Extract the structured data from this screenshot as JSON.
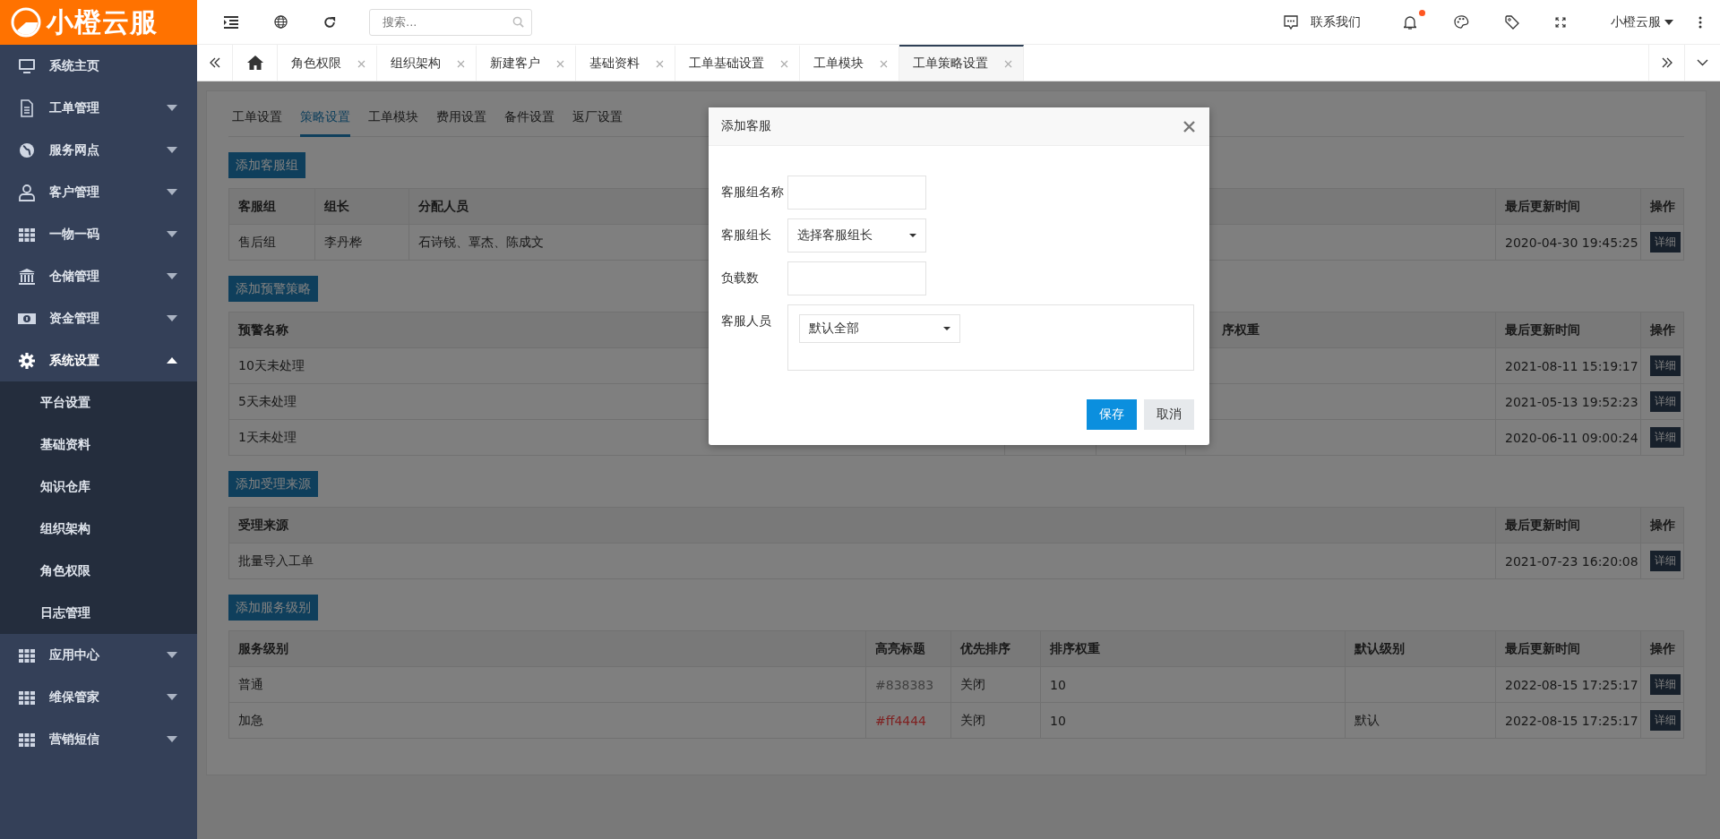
{
  "logo": {
    "text": "小橙云服"
  },
  "sidebar": {
    "items": [
      {
        "label": "系统主页",
        "kind": "link"
      },
      {
        "label": "工单管理",
        "kind": "menu",
        "expanded": false
      },
      {
        "label": "服务网点",
        "kind": "menu",
        "expanded": false
      },
      {
        "label": "客户管理",
        "kind": "menu",
        "expanded": false
      },
      {
        "label": "一物一码",
        "kind": "menu",
        "expanded": false
      },
      {
        "label": "仓储管理",
        "kind": "menu",
        "expanded": false
      },
      {
        "label": "资金管理",
        "kind": "menu",
        "expanded": false
      },
      {
        "label": "系统设置",
        "kind": "menu",
        "expanded": true,
        "children": [
          {
            "label": "平台设置"
          },
          {
            "label": "基础资料"
          },
          {
            "label": "知识仓库"
          },
          {
            "label": "组织架构"
          },
          {
            "label": "角色权限"
          },
          {
            "label": "日志管理"
          }
        ]
      },
      {
        "label": "应用中心",
        "kind": "menu",
        "expanded": false
      },
      {
        "label": "维保管家",
        "kind": "menu",
        "expanded": false
      },
      {
        "label": "营销短信",
        "kind": "menu",
        "expanded": false
      }
    ]
  },
  "toolbar": {
    "search": {
      "placeholder": "搜索..."
    },
    "contact": "联系我们",
    "notifications": {
      "unread": true
    },
    "user": "小橙云服"
  },
  "tabs": [
    {
      "label": "角色权限",
      "selected": false
    },
    {
      "label": "组织架构",
      "selected": false
    },
    {
      "label": "新建客户",
      "selected": false
    },
    {
      "label": "基础资料",
      "selected": false
    },
    {
      "label": "工单基础设置",
      "selected": false
    },
    {
      "label": "工单模块",
      "selected": false
    },
    {
      "label": "工单策略设置",
      "selected": true
    }
  ],
  "page": {
    "tabs": [
      {
        "label": "工单设置",
        "selected": false
      },
      {
        "label": "策略设置",
        "selected": true
      },
      {
        "label": "工单模块",
        "selected": false
      },
      {
        "label": "费用设置",
        "selected": false
      },
      {
        "label": "备件设置",
        "selected": false
      },
      {
        "label": "返厂设置",
        "selected": false
      }
    ],
    "sections": [
      {
        "kind": "group",
        "button": "添加客服组",
        "columns": [
          "客服组",
          "组长",
          "分配人员",
          "最后更新时间",
          "操作"
        ],
        "rows": [
          {
            "cells": [
              "售后组",
              "李丹桦",
              "石诗锐、覃杰、陈成文",
              "2020-04-30 19:45:25",
              "详细"
            ]
          }
        ]
      },
      {
        "kind": "warning",
        "button": "添加预警策略",
        "columns": [
          "预警名称",
          null,
          null,
          "序权重",
          "最后更新时间",
          "操作"
        ],
        "rows": [
          {
            "cells": [
              "10天未处理",
              null,
              null,
              null,
              "2021-08-11 15:19:17",
              "详细"
            ]
          },
          {
            "cells": [
              "5天未处理",
              null,
              null,
              null,
              "2021-05-13 19:52:23",
              "详细"
            ]
          },
          {
            "cells": [
              "1天未处理",
              null,
              null,
              null,
              "2020-06-11 09:00:24",
              "详细"
            ]
          }
        ]
      },
      {
        "kind": "source",
        "button": "添加受理来源",
        "columns": [
          "受理来源",
          "最后更新时间",
          "操作"
        ],
        "rows": [
          {
            "cells": [
              "批量导入工单",
              "2021-07-23 16:20:08",
              "详细"
            ]
          }
        ]
      },
      {
        "kind": "level",
        "button": "添加服务级别",
        "columns": [
          "服务级别",
          "高亮标题",
          "优先排序",
          "排序权重",
          "默认级别",
          "最后更新时间",
          "操作"
        ],
        "rows": [
          {
            "color": "#414141",
            "cells": [
              "普通",
              "#838383",
              "关闭",
              "10",
              null,
              "2022-08-15 17:25:17",
              "详细"
            ]
          },
          {
            "color": "#7f2222",
            "cells": [
              "加急",
              "#ff4444",
              "关闭",
              "10",
              "默认",
              "2022-08-15 17:25:17",
              "详细"
            ]
          }
        ]
      }
    ]
  },
  "dialog": {
    "title": "添加客服",
    "fields": [
      {
        "kind": "text",
        "label": "客服组名称"
      },
      {
        "kind": "select",
        "label": "客服组长",
        "value": "选择客服组长"
      },
      {
        "kind": "text",
        "label": "负载数"
      },
      {
        "kind": "multiselect",
        "label": "客服人员",
        "value": "默认全部"
      }
    ],
    "buttons": [
      {
        "label": "保存",
        "kind": "primary"
      },
      {
        "label": "取消",
        "kind": "secondary"
      }
    ]
  }
}
